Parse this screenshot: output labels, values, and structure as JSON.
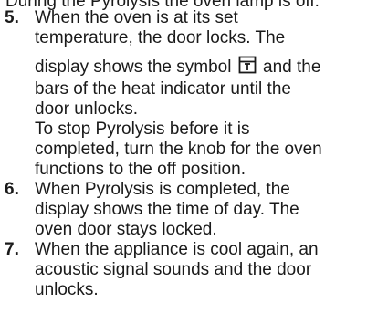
{
  "top_clipped_line": "During the Pyrolysis the oven lamp is off.",
  "steps": [
    {
      "number": "5.",
      "lines": [
        "When the oven is at its set",
        "temperature, the door locks. The",
        "display shows the symbol",
        "and the",
        "bars of the heat indicator until the",
        "door unlocks.",
        "To stop Pyrolysis before it is",
        "completed, turn the knob for the oven",
        "functions to the off position."
      ],
      "icon": "door-lock-icon"
    },
    {
      "number": "6.",
      "lines": [
        "When Pyrolysis is completed, the",
        "display shows the time of day. The",
        "oven door stays locked."
      ]
    },
    {
      "number": "7.",
      "lines": [
        "When the appliance is cool again, an",
        "acoustic signal sounds and the door",
        "unlocks."
      ]
    }
  ]
}
